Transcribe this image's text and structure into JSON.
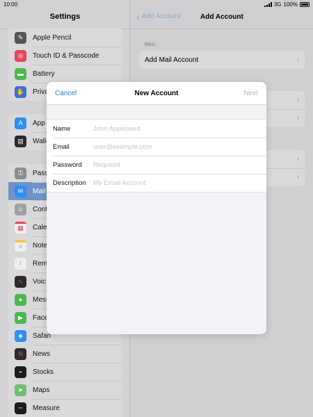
{
  "status_bar": {
    "time": "10:00",
    "network": "3G",
    "battery": "100%"
  },
  "sidebar": {
    "title": "Settings",
    "groups": [
      {
        "items": [
          {
            "label": "Apple Pencil",
            "icon": "pencil-icon",
            "color": "#555558"
          },
          {
            "label": "Touch ID & Passcode",
            "icon": "fingerprint-icon",
            "color": "#e0475a"
          },
          {
            "label": "Battery",
            "icon": "battery-icon",
            "color": "#4cb950"
          },
          {
            "label": "Priva",
            "icon": "hand-icon",
            "color": "#3a72d6"
          }
        ]
      },
      {
        "items": [
          {
            "label": "App",
            "icon": "app-store-icon",
            "color": "#2f8ef0"
          },
          {
            "label": "Walle",
            "icon": "wallet-icon",
            "color": "#2b2b2b"
          }
        ]
      },
      {
        "items": [
          {
            "label": "Pass",
            "icon": "key-icon",
            "color": "#8c8c90"
          },
          {
            "label": "Mail",
            "icon": "mail-icon",
            "color": "#2f8ef0",
            "selected": true
          },
          {
            "label": "Cont",
            "icon": "contacts-icon",
            "color": "#a0a0a4"
          },
          {
            "label": "Cale",
            "icon": "calendar-icon",
            "color": "#f0f0f0"
          },
          {
            "label": "Note",
            "icon": "notes-icon",
            "color": "#f2c94c"
          },
          {
            "label": "Rem",
            "icon": "reminders-icon",
            "color": "#f0f0f0"
          },
          {
            "label": "Voic",
            "icon": "voice-memos-icon",
            "color": "#2b2b2b"
          },
          {
            "label": "Mess",
            "icon": "messages-icon",
            "color": "#4cb950"
          },
          {
            "label": "Face",
            "icon": "facetime-icon",
            "color": "#4cb950"
          },
          {
            "label": "Safari",
            "icon": "safari-icon",
            "color": "#2f8ef0"
          },
          {
            "label": "News",
            "icon": "news-icon",
            "color": "#2b2b2b"
          },
          {
            "label": "Stocks",
            "icon": "stocks-icon",
            "color": "#1c1c1e"
          },
          {
            "label": "Maps",
            "icon": "maps-icon",
            "color": "#6fbf73"
          },
          {
            "label": "Measure",
            "icon": "measure-icon",
            "color": "#1c1c1e"
          }
        ]
      }
    ]
  },
  "detail": {
    "back_label": "Add Account",
    "title": "Add Account",
    "section_label": "MAIL",
    "add_mail_account": "Add Mail Account"
  },
  "modal": {
    "cancel": "Cancel",
    "title": "New Account",
    "next": "Next",
    "fields": [
      {
        "label": "Name",
        "placeholder": "John Appleseed",
        "value": ""
      },
      {
        "label": "Email",
        "placeholder": "user@example.com",
        "value": ""
      },
      {
        "label": "Password",
        "placeholder": "Required",
        "value": ""
      },
      {
        "label": "Description",
        "placeholder": "My Email Account",
        "value": ""
      }
    ]
  },
  "colors": {
    "accent": "#3478c6",
    "selected_row": "#6f93c7"
  }
}
